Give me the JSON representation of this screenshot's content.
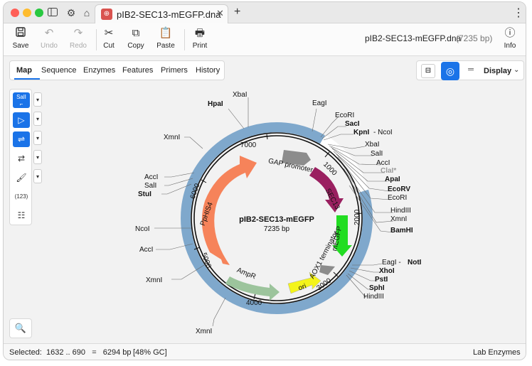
{
  "window": {
    "tab_title": "pIB2-SEC13-mEGFP.dna",
    "tab_close": "✕",
    "new_tab": "+",
    "menu": "⋮"
  },
  "toolbar": {
    "save": "Save",
    "undo": "Undo",
    "redo": "Redo",
    "cut": "Cut",
    "copy": "Copy",
    "paste": "Paste",
    "print": "Print",
    "info": "Info",
    "doc_name": "pIB2-SEC13-mEGFP.dna",
    "doc_bp": "(7235 bp)"
  },
  "view_tabs": [
    "Map",
    "Sequence",
    "Enzymes",
    "Features",
    "Primers",
    "History"
  ],
  "display_label": "Display",
  "left_tools": {
    "sali_label": "SalI",
    "count_label": "(123)"
  },
  "map": {
    "name": "pIB2-SEC13-mEGFP",
    "length_label": "7235 bp",
    "ticks": [
      "1000",
      "2000",
      "3000",
      "4000",
      "5000",
      "6000",
      "7000"
    ],
    "features": [
      {
        "label": "GAP promoter",
        "color": "#8c8c8c"
      },
      {
        "label": "SEC13",
        "color": "#9a2060"
      },
      {
        "label": "mEGFP",
        "color": "#22dd22"
      },
      {
        "label": "AOX1 terminator",
        "color": "#8c8c8c"
      },
      {
        "label": "ori",
        "color": "#f4f41a"
      },
      {
        "label": "AmpR",
        "color": "#9cc49c"
      },
      {
        "label": "PpHIS4",
        "color": "#f6835a"
      }
    ],
    "enzymes": {
      "top": [
        "XbaI",
        "HpaI",
        "EagI"
      ],
      "right": [
        "EcoRI",
        "SacI",
        "KpnI",
        "- NcoI",
        "XbaI",
        "SalI",
        "AccI",
        "ClaI*",
        "ApaI",
        "EcoRV",
        "EcoRI",
        "HindIII",
        "XmnI",
        "BamHI"
      ],
      "right_lower": [
        "EagI -",
        "NotI",
        "XhoI",
        "PstI",
        "SphI",
        "HindIII"
      ],
      "left": [
        "XmnI",
        "AccI",
        "SalI",
        "StuI",
        "NcoI",
        "AccI",
        "XmnI"
      ],
      "bottom": [
        "XmnI"
      ]
    }
  },
  "status": {
    "selected": "Selected:  1632 .. 690   =   6294 bp",
    "gc": "[48% GC]",
    "enzymes": "Lab Enzymes"
  }
}
